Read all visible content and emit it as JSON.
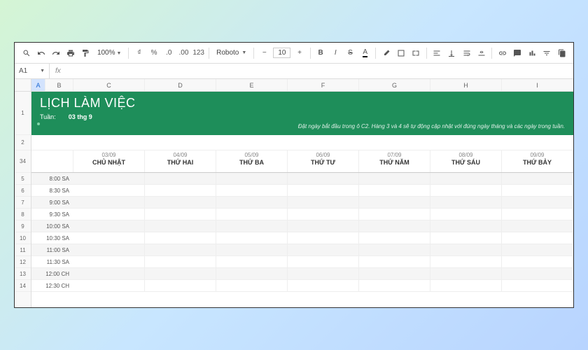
{
  "toolbar": {
    "zoom": "100%",
    "font": "Roboto",
    "font_size": "10"
  },
  "namebox": "A1",
  "fx_label": "fx",
  "columns": [
    "A",
    "B",
    "C",
    "D",
    "E",
    "F",
    "G",
    "H",
    "I"
  ],
  "selected_col": "A",
  "row_numbers_banner": "1",
  "row_numbers_gap": "2",
  "row_numbers_days": [
    "3",
    "4"
  ],
  "row_numbers": [
    "5",
    "6",
    "7",
    "8",
    "9",
    "10",
    "11",
    "12",
    "13",
    "14"
  ],
  "banner": {
    "title": "LỊCH LÀM VIỆC",
    "week_label": "Tuần:",
    "week_value": "03 thg 9",
    "note": "Đặt ngày bắt đầu trong ô C2. Hàng 3 và 4 sẽ tự động cập nhật với đúng ngày tháng và các ngày trong tuần."
  },
  "days": [
    {
      "date": "03/09",
      "name": "CHỦ NHẬT"
    },
    {
      "date": "04/09",
      "name": "THỨ HAI"
    },
    {
      "date": "05/09",
      "name": "THỨ BA"
    },
    {
      "date": "06/09",
      "name": "THỨ TƯ"
    },
    {
      "date": "07/09",
      "name": "THỨ NĂM"
    },
    {
      "date": "08/09",
      "name": "THỨ SÁU"
    },
    {
      "date": "09/09",
      "name": "THỨ BẢY"
    }
  ],
  "times": [
    "8:00 SA",
    "8:30 SA",
    "9:00 SA",
    "9:30 SA",
    "10:00 SA",
    "10:30 SA",
    "11:00 SA",
    "11:30 SA",
    "12:00 CH",
    "12:30 CH"
  ]
}
